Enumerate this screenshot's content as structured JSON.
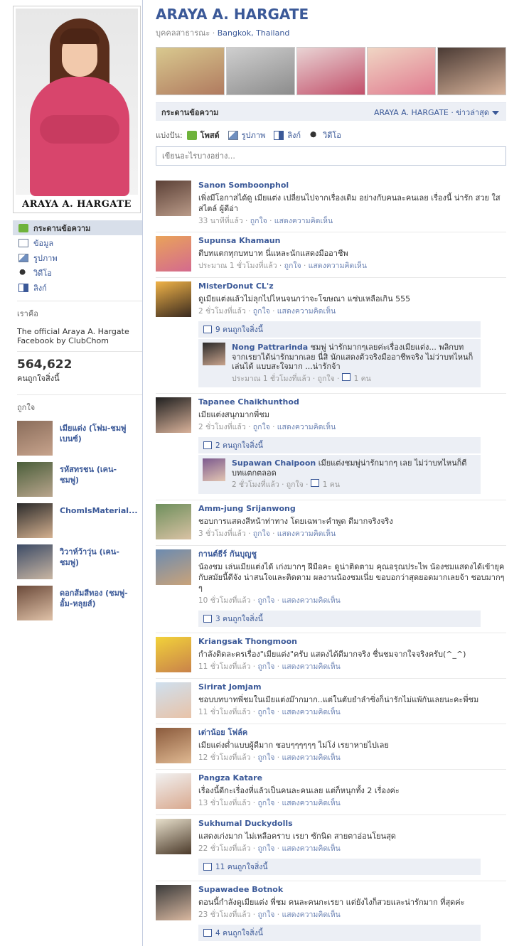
{
  "profile": {
    "name": "ARAYA A. HARGATE",
    "caption": "ARAYA A. HARGATE",
    "category": "บุคคลสาธารณะ",
    "location": "Bangkok, Thailand"
  },
  "nav": {
    "wall": "กระดานข้อความ",
    "info": "ข้อมูล",
    "photos": "รูปภาพ",
    "videos": "วิดีโอ",
    "links": "ลิงก์"
  },
  "about": {
    "title": "เราคือ",
    "text": "The official Araya A. Hargate Facebook by ClubChom",
    "like_count": "564,622",
    "like_count_label": "คนถูกใจสิ่งนี้"
  },
  "likes": {
    "title": "ถูกใจ",
    "items": [
      {
        "name": "เมียแต่ง (โฟม-ชมพู่ เบนซ์)",
        "colors": [
          "#8a6d5b",
          "#c7a38c"
        ]
      },
      {
        "name": "รหัสทรชน (เคน-ชมพู่)",
        "colors": [
          "#4a5e3a",
          "#b9a58d"
        ]
      },
      {
        "name": "ChomIsMaterial...",
        "colors": [
          "#2b2b2b",
          "#d4b08f"
        ]
      },
      {
        "name": "วิวาห์ว้าวุ่น (เคน-ชมพู่)",
        "colors": [
          "#3c4b66",
          "#c9b6a3"
        ]
      },
      {
        "name": "ดอกส้มสีทอง (ชมพู่-อั้ม-หลุยส์)",
        "colors": [
          "#6b4a3a",
          "#e0c2a8"
        ]
      }
    ]
  },
  "header_photos": [
    {
      "colors": [
        "#d9c98f",
        "#b07a5f"
      ]
    },
    {
      "colors": [
        "#cfcfcf",
        "#8c8c8c"
      ]
    },
    {
      "colors": [
        "#e9d4d4",
        "#c24f6a"
      ]
    },
    {
      "colors": [
        "#f0d6c4",
        "#e07a8f"
      ]
    },
    {
      "colors": [
        "#4a3a34",
        "#d8b39a"
      ]
    }
  ],
  "wall": {
    "title": "กระดานข้อความ",
    "filter": "ARAYA A. HARGATE · ข่าวล่าสุด",
    "share_label": "แบ่งปัน:",
    "share_post": "โพสต์",
    "share_photo": "รูปภาพ",
    "share_link": "ลิงก์",
    "share_video": "วิดีโอ",
    "composer_placeholder": "เขียนอะไรบางอย่าง..."
  },
  "actions": {
    "like": "ถูกใจ",
    "comment": "แสดงความคิดเห็น"
  },
  "posts": [
    {
      "author": "Sanon Somboonphol",
      "message": "เพิ่งมีโอกาสได้ดู เมียแต่ง เปลี่ยนไปจากเรื่องเดิม อย่างกับคนละคนเลย เรื่องนี้ น่ารัก สวย ใส สไตล์ ผู้ดีอ่า",
      "time": "33 นาทีที่แล้ว",
      "colors": [
        "#5b4036",
        "#b99a88"
      ]
    },
    {
      "author": "Supunsa Khamaun",
      "message": "ตีบทแตกทุกบทบาท นี่แหละนักแสดงมืออาชีพ",
      "time": "ประมาณ 1 ชั่วโมงที่แล้ว",
      "colors": [
        "#e9a35a",
        "#d46a8e"
      ]
    },
    {
      "author": "MisterDonut CL'z",
      "message": "ดูเมียแต่งแล้วไม่ลุกไปไหนจนกว่าจะโฆษณา แซ่บเหลือเกิน 555",
      "time": "2 ชั่วโมงที่แล้ว",
      "likes": "9 คนถูกใจสิ่งนี้",
      "colors": [
        "#f0b348",
        "#3a2a1f"
      ],
      "comment": {
        "author": "Nong Pattrarinda",
        "text": "ชมพู่ น่ารักมากๆเลยค่ะเรื่องเมียแต่ง... พลิกบทจากเรยาได้น่ารักมากเลย นี่สิ นักแสดงตัวจริงมืออาชีพจริง ไม่ว่าบทไหนก็เล่นได้ แบบสะใจมาก ...น่ารักจ้า",
        "time": "ประมาณ 1 ชั่วโมงที่แล้ว",
        "likes": "1 คน",
        "colors": [
          "#2a2a2a",
          "#c9a48d"
        ]
      }
    },
    {
      "author": "Tapanee Chaikhunthod",
      "message": "เมียแต่งสนุกมากพี่ชม",
      "time": "2 ชั่วโมงที่แล้ว",
      "likes": "2 คนถูกใจสิ่งนี้",
      "colors": [
        "#1f1f1f",
        "#d9b29a"
      ],
      "comment": {
        "author": "Supawan Chaipoon",
        "text": "เมียแต่งชมพู่น่ารักมากๆ เลย ไม่ว่าบทไหนก็ตีบทแตกตลอด",
        "time": "2 ชั่วโมงที่แล้ว",
        "likes": "1 คน",
        "colors": [
          "#7c5a8e",
          "#e3c6b2"
        ]
      }
    },
    {
      "author": "Amm-jung Srijanwong",
      "message": "ชอบการแสดงสีหน้าท่าทาง โดยเฉพาะคำพูด ดีมากจริงจริง",
      "time": "3 ชั่วโมงที่แล้ว",
      "colors": [
        "#6e8f5c",
        "#d9c2a4"
      ]
    },
    {
      "author": "กานต์ธีร์ กันบุญชู",
      "message": "น้องชม เล่นเมียแต่งได้ เก่งมากๆ ฝีมือคะ ดูน่าติดตาม คุณอรุณประไพ น้องชมแสดงได้เข้ายุคกับสมัยนี้ดีจัง น่าสนใจและติดตาม ผลงานน้องชมเนี่ย ขอบอกว่าสุดยอดมากเลยจ้า ชอบมากๆๆ",
      "time": "10 ชั่วโมงที่แล้ว",
      "likes": "3 คนถูกใจสิ่งนี้",
      "colors": [
        "#6c8bb0",
        "#c9a37a"
      ]
    },
    {
      "author": "Kriangsak Thongmoon",
      "message": "กำลังติดละครเรื่อง\"เมียแต่ง\"ครับ แสดงได้ดีมากจริง ชื่นชมจากใจจริงครับ(^_^)",
      "time": "11 ชั่วโมงที่แล้ว",
      "colors": [
        "#f2d23a",
        "#c9824a"
      ]
    },
    {
      "author": "Sirirat Jomjam",
      "message": "ชอบบทบาทพี่ชมในเมียแต่งม๊ากมาก..แต่ในตับยำลำซิ่งก็น่ารักไม่แพ้กันเลยนะคะพี่ชม",
      "time": "11 ชั่วโมงที่แล้ว",
      "colors": [
        "#cfe0ef",
        "#e8c3a8"
      ]
    },
    {
      "author": "เต่าน้อย โฟล์ค",
      "message": "เมียแต่งต่ำแบบผู้ดีมาก ชอบๆๆๆๆๆๆ ไม่โง่ เรยาหายไปเลย",
      "time": "12 ชั่วโมงที่แล้ว",
      "colors": [
        "#8a5a3c",
        "#e0b992"
      ]
    },
    {
      "author": "Pangza Katare",
      "message": "เรื่องนี้ดีกะเรื่องที่แล้วเป็นคนละคนเลย แต่ก็หนุกทั้ง 2 เรื่องค่ะ",
      "time": "13 ชั่วโมงที่แล้ว",
      "colors": [
        "#f1f1f1",
        "#d9a98f"
      ]
    },
    {
      "author": "Sukhumal Duckydolls",
      "message": "แสดงเก่งมาก ไม่เหลือคราบ เรยา ซักนิด สายตาอ่อนโยนสุด",
      "time": "22 ชั่วโมงที่แล้ว",
      "likes": "11 คนถูกใจสิ่งนี้",
      "colors": [
        "#e8e0cc",
        "#4b3a2a"
      ]
    },
    {
      "author": "Supawadee Botnok",
      "message": "ตอนนี้กำลังดูเมียแต่ง พี่ชม คนละคนกะเรยา แต่ยังไงก็สวยและน่ารักมาก ที่สุดค่ะ",
      "time": "23 ชั่วโมงที่แล้ว",
      "likes": "4 คนถูกใจสิ่งนี้",
      "colors": [
        "#3a3a3a",
        "#d9b8a0"
      ]
    }
  ]
}
